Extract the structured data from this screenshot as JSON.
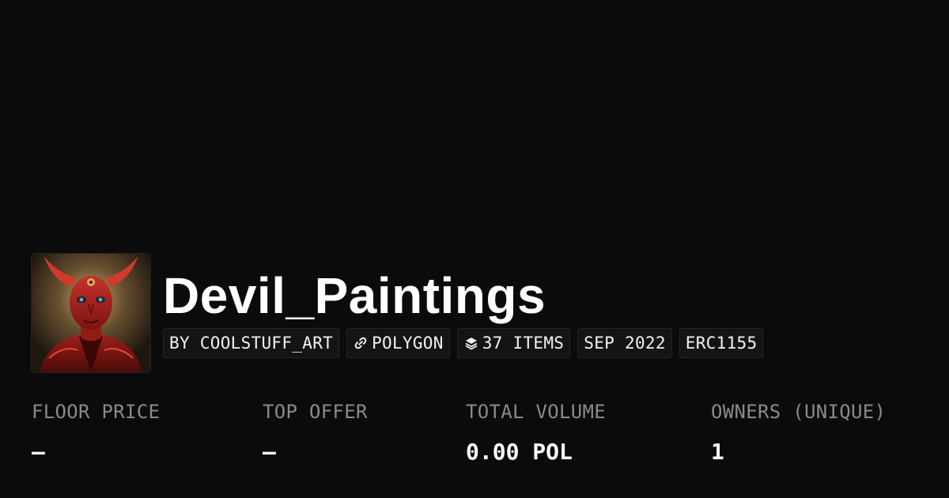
{
  "collection": {
    "name": "Devil_Paintings",
    "avatar_icon": "devil-painting-avatar"
  },
  "tags": {
    "creator": "BY COOLSTUFF_ART",
    "chain": "POLYGON",
    "chain_icon": "polygon-link-icon",
    "items": "37 ITEMS",
    "items_icon": "layers-icon",
    "created": "SEP 2022",
    "standard": "ERC1155"
  },
  "stats": {
    "floor_price": {
      "label": "FLOOR PRICE",
      "value": "–"
    },
    "top_offer": {
      "label": "TOP OFFER",
      "value": "–"
    },
    "total_volume": {
      "label": "TOTAL VOLUME",
      "value": "0.00 POL"
    },
    "owners": {
      "label": "OWNERS (UNIQUE)",
      "value": "1"
    }
  },
  "colors": {
    "background": "#0b0b0b",
    "label_gray": "#8a8a8a",
    "tag_background": "#141414",
    "tag_border": "#262626"
  }
}
